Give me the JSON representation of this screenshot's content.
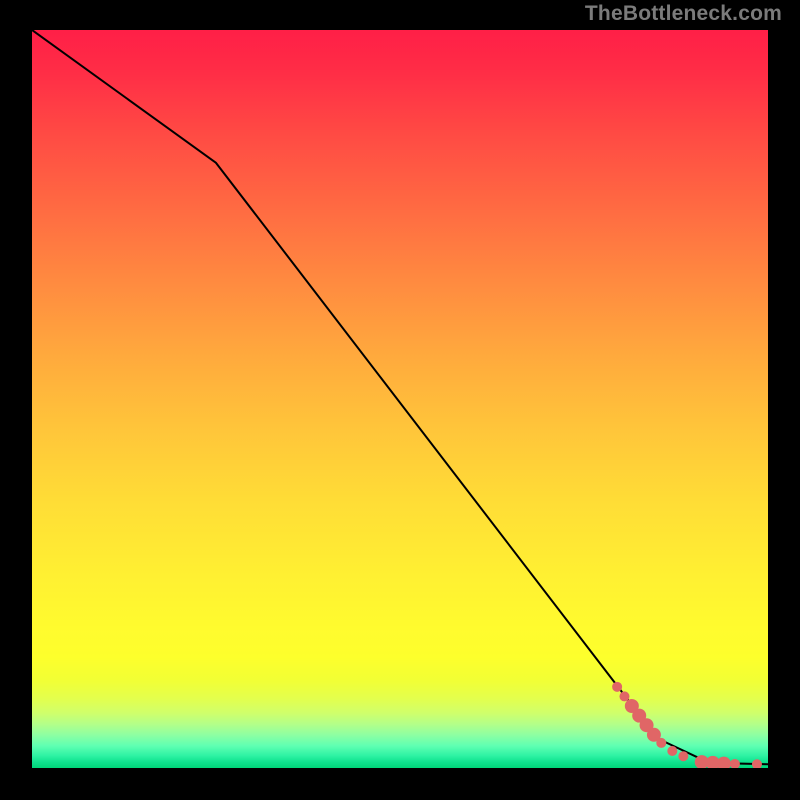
{
  "attribution": "TheBottleneck.com",
  "chart_data": {
    "type": "line",
    "title": "",
    "xlabel": "",
    "ylabel": "",
    "xlim": [
      0,
      100
    ],
    "ylim": [
      0,
      100
    ],
    "curve": [
      {
        "x": 0,
        "y": 100
      },
      {
        "x": 25,
        "y": 82
      },
      {
        "x": 85,
        "y": 4
      },
      {
        "x": 92,
        "y": 0.7
      },
      {
        "x": 100,
        "y": 0.5
      }
    ],
    "series": [
      {
        "name": "points-coral",
        "color": "#e06666",
        "radius_small": 5,
        "radius_large": 7,
        "points": [
          {
            "x": 79.5,
            "y": 11.0,
            "r": "small"
          },
          {
            "x": 80.5,
            "y": 9.7,
            "r": "small"
          },
          {
            "x": 81.5,
            "y": 8.4,
            "r": "large"
          },
          {
            "x": 82.5,
            "y": 7.1,
            "r": "large"
          },
          {
            "x": 83.5,
            "y": 5.8,
            "r": "large"
          },
          {
            "x": 84.5,
            "y": 4.5,
            "r": "large"
          },
          {
            "x": 85.5,
            "y": 3.4,
            "r": "small"
          },
          {
            "x": 87.0,
            "y": 2.3,
            "r": "small"
          },
          {
            "x": 88.5,
            "y": 1.6,
            "r": "small"
          },
          {
            "x": 91.0,
            "y": 0.8,
            "r": "large"
          },
          {
            "x": 92.5,
            "y": 0.7,
            "r": "large"
          },
          {
            "x": 94.0,
            "y": 0.6,
            "r": "large"
          },
          {
            "x": 95.5,
            "y": 0.55,
            "r": "small"
          },
          {
            "x": 98.5,
            "y": 0.5,
            "r": "small"
          }
        ]
      }
    ]
  }
}
